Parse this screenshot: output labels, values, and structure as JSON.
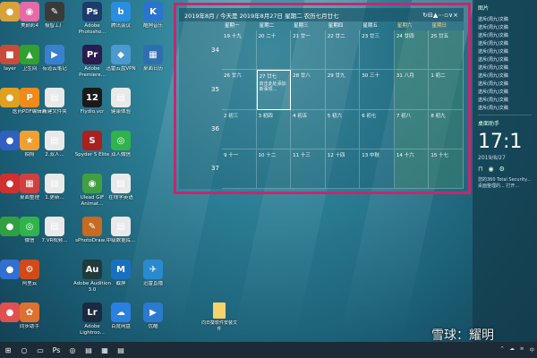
{
  "desktop_icons": [
    {
      "label": "",
      "col": 0,
      "row": 0,
      "glyph": "●",
      "color": "#d8a23a"
    },
    {
      "label": "美颜彩4",
      "col": 1,
      "row": 0,
      "glyph": "◉",
      "color": "#e56aa6"
    },
    {
      "label": "极智工厂",
      "col": 2,
      "row": 0,
      "glyph": "✎",
      "color": "#3a3a3a"
    },
    {
      "label": "Adobe Photosho...",
      "col": 3,
      "row": 0,
      "glyph": "Ps",
      "color": "#1d3b6b"
    },
    {
      "label": "腾讯会议",
      "col": 4,
      "row": 0,
      "glyph": "b",
      "color": "#2a8de0"
    },
    {
      "label": "酷狗音乐",
      "col": 5,
      "row": 0,
      "glyph": "K",
      "color": "#2a74d0"
    },
    {
      "label": "layer",
      "col": 0,
      "row": 1,
      "glyph": "■",
      "color": "#c84b3a"
    },
    {
      "label": "卫生间",
      "col": 1,
      "row": 1,
      "glyph": "▲",
      "color": "#30a030"
    },
    {
      "label": "有道云笔记",
      "col": 2,
      "row": 1,
      "glyph": "▶",
      "color": "#3a80d0"
    },
    {
      "label": "Adobe Premiere...",
      "col": 3,
      "row": 1,
      "glyph": "Pr",
      "color": "#2b1b4f"
    },
    {
      "label": "迅雷云盘VPN",
      "col": 4,
      "row": 1,
      "glyph": "◆",
      "color": "#4a9ad0"
    },
    {
      "label": "桌面日历",
      "col": 5,
      "row": 1,
      "glyph": "▦",
      "color": "#2e6fb0"
    },
    {
      "label": "",
      "col": 0,
      "row": 2,
      "glyph": "●",
      "color": "#e0a020"
    },
    {
      "label": "医药PDF编辑器",
      "col": 1,
      "row": 2,
      "glyph": "P",
      "color": "#f08a1a"
    },
    {
      "label": "新建文件夹",
      "col": 2,
      "row": 2,
      "glyph": "▤",
      "color": "#e9e9e9"
    },
    {
      "label": "Flydio.vcr",
      "col": 3,
      "row": 2,
      "glyph": "12",
      "color": "#1a1a1a"
    },
    {
      "label": "健康体验",
      "col": 4,
      "row": 2,
      "glyph": "▤",
      "color": "#e9e9e9"
    },
    {
      "label": "",
      "col": 0,
      "row": 3,
      "glyph": "●",
      "color": "#3060c0"
    },
    {
      "label": "拍照",
      "col": 1,
      "row": 3,
      "glyph": "★",
      "color": "#f0a030"
    },
    {
      "label": "2.双人...",
      "col": 2,
      "row": 3,
      "glyph": "▤",
      "color": "#e9e9e9"
    },
    {
      "label": "Spyder 5 Elite",
      "col": 3,
      "row": 3,
      "glyph": "S",
      "color": "#aa2020"
    },
    {
      "label": "双人微信",
      "col": 4,
      "row": 3,
      "glyph": "◎",
      "color": "#2fb34a"
    },
    {
      "label": "",
      "col": 0,
      "row": 4,
      "glyph": "●",
      "color": "#d03030"
    },
    {
      "label": "桌面整理",
      "col": 1,
      "row": 4,
      "glyph": "▦",
      "color": "#d04040"
    },
    {
      "label": "1.更新...",
      "col": 2,
      "row": 4,
      "glyph": "▤",
      "color": "#e9e9e9"
    },
    {
      "label": "Ulead GIF Animat...",
      "col": 3,
      "row": 4,
      "glyph": "◉",
      "color": "#40a040"
    },
    {
      "label": "在线学英语",
      "col": 4,
      "row": 4,
      "glyph": "▤",
      "color": "#e9e9e9"
    },
    {
      "label": "",
      "col": 0,
      "row": 5,
      "glyph": "●",
      "color": "#30a040"
    },
    {
      "label": "微信",
      "col": 1,
      "row": 5,
      "glyph": "◎",
      "color": "#2fb34a"
    },
    {
      "label": "7.VR视频...",
      "col": 2,
      "row": 5,
      "glyph": "▤",
      "color": "#e9e9e9"
    },
    {
      "label": "sPhotoDraw...",
      "col": 3,
      "row": 5,
      "glyph": "✎",
      "color": "#c86a20"
    },
    {
      "label": "中级数据库...",
      "col": 4,
      "row": 5,
      "glyph": "▤",
      "color": "#e9e9e9"
    },
    {
      "label": "",
      "col": 0,
      "row": 6,
      "glyph": "●",
      "color": "#3070d0"
    },
    {
      "label": "阿里云",
      "col": 1,
      "row": 6,
      "glyph": "⚙",
      "color": "#d04a1a"
    },
    {
      "label": "Adobe Audition 3.0",
      "col": 3,
      "row": 6,
      "glyph": "Au",
      "color": "#1f3b3b"
    },
    {
      "label": "截屏",
      "col": 4,
      "row": 6,
      "glyph": "M",
      "color": "#1a70c0"
    },
    {
      "label": "迅雷直播",
      "col": 5,
      "row": 6,
      "glyph": "✈",
      "color": "#2a8ad0"
    },
    {
      "label": "",
      "col": 0,
      "row": 7,
      "glyph": "●",
      "color": "#e05050"
    },
    {
      "label": "同步助手",
      "col": 1,
      "row": 7,
      "glyph": "✿",
      "color": "#e07030"
    },
    {
      "label": "Adobe Lightroo...",
      "col": 3,
      "row": 7,
      "glyph": "Lr",
      "color": "#1a2a40"
    },
    {
      "label": "百度网盘",
      "col": 4,
      "row": 7,
      "glyph": "☁",
      "color": "#2a80e0"
    },
    {
      "label": "优酷",
      "col": 5,
      "row": 7,
      "glyph": "▶",
      "color": "#2a7ad0"
    }
  ],
  "folder": {
    "label": "向日葵软件安装文件"
  },
  "calendar": {
    "title": "2019年8月 / 今天是 2019年8月27日 星期二 农历七月廿七",
    "toolbar_icons": [
      "↻",
      "⊟",
      "▲",
      "⋯",
      "▫",
      "∨",
      "×"
    ],
    "weekdays": [
      "星期一",
      "星期二",
      "星期三",
      "星期四",
      "星期五",
      "星期六",
      "星期日"
    ],
    "weekend_cols": [
      5,
      6
    ],
    "week_numbers": [
      "34",
      "35",
      "36",
      "37"
    ],
    "rows": [
      [
        "19 十九",
        "20 二十",
        "21 廿一",
        "22 廿二",
        "23 廿三",
        "24 廿四",
        "25 廿五"
      ],
      [
        "26 廿六",
        "27 廿七",
        "28 廿八",
        "29 廿九",
        "30 三十",
        "31 八月",
        "1 初二"
      ],
      [
        "2 初三",
        "3 初四",
        "4 初五",
        "5 初六",
        "6 初七",
        "7 初八",
        "8 初九"
      ],
      [
        "9 十一",
        "10 十二",
        "11 十三",
        "12 十四",
        "13 中秋",
        "14 十六",
        "15 十七"
      ]
    ],
    "today": {
      "row": 1,
      "col": 1
    },
    "event_text": "双击此处添加新事项..."
  },
  "right_panel": {
    "title": "图片",
    "items": [
      "送斥(周九)文稿",
      "送斥(周九)文稿",
      "送斥(周九)文稿",
      "送斥(周九)文稿",
      "送斥(周九)文稿",
      "送斥(周九)文稿",
      "送斥(周九)文稿",
      "送斥(周九)文稿",
      "送斥(周九)文稿",
      "送斥(周九)文稿",
      "送斥(周九)文稿",
      "送斥(周九)文稿"
    ],
    "clock_title": "桌面助手",
    "time": "17:1",
    "date": "2019/8/27",
    "footer": "您的360 Total Security... 桌面整理的... 打开..."
  },
  "taskbar": {
    "icons": [
      "⊞",
      "○",
      "▭",
      "Ps",
      "◎",
      "▤",
      "▦",
      "▤"
    ],
    "tray": [
      "^",
      "☁",
      "≋",
      "中"
    ]
  },
  "watermark": "雪球：耀明"
}
